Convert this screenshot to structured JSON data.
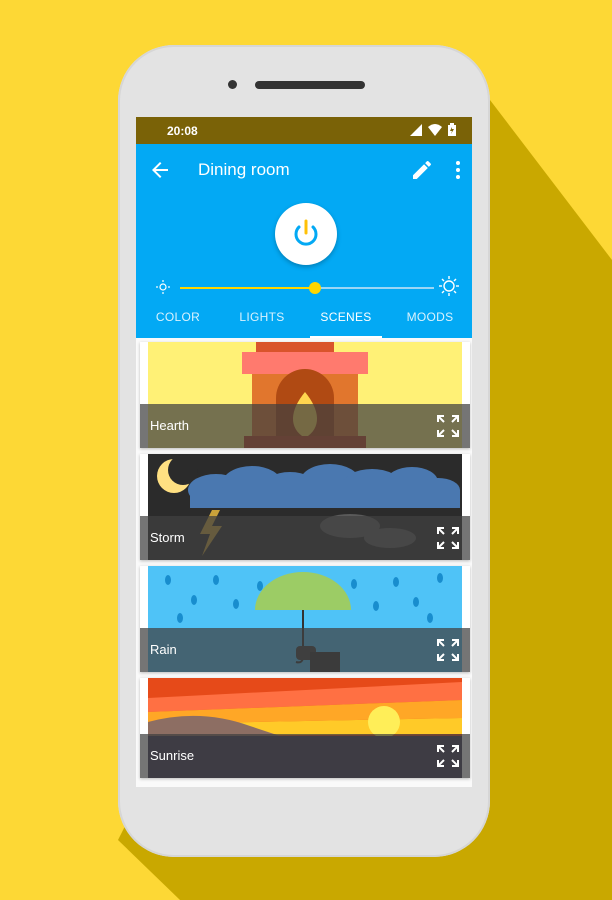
{
  "status": {
    "time": "20:08"
  },
  "appbar": {
    "title": "Dining room"
  },
  "brightness": {
    "level": 0.53
  },
  "tabs": [
    {
      "label": "COLOR"
    },
    {
      "label": "LIGHTS"
    },
    {
      "label": "SCENES"
    },
    {
      "label": "MOODS"
    }
  ],
  "active_tab": "SCENES",
  "scenes": [
    {
      "label": "Hearth"
    },
    {
      "label": "Storm"
    },
    {
      "label": "Rain"
    },
    {
      "label": "Sunrise"
    }
  ],
  "colors": {
    "background": "#fdd835",
    "appbar": "#03a9f4",
    "statusbar": "#7a6207",
    "accent": "#ffd600"
  }
}
